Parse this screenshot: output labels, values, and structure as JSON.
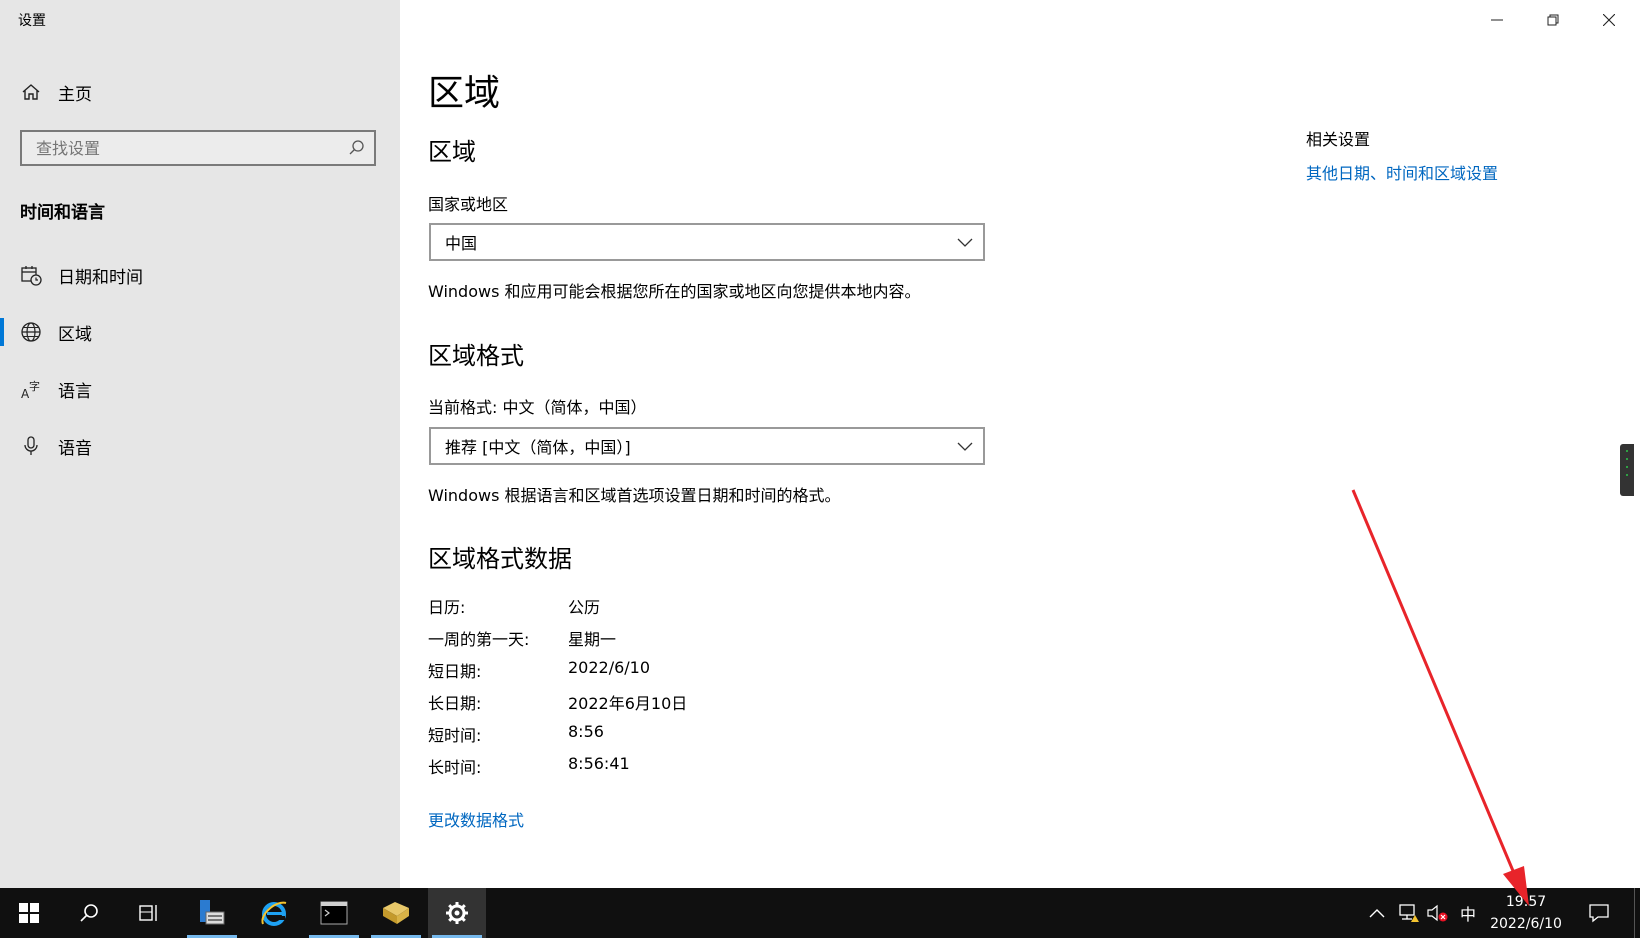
{
  "window": {
    "title": "设置"
  },
  "sidebar": {
    "home_label": "主页",
    "search_placeholder": "查找设置",
    "section_label": "时间和语言",
    "items": [
      {
        "label": "日期和时间",
        "icon": "calendar-clock-icon",
        "active": false
      },
      {
        "label": "区域",
        "icon": "globe-icon",
        "active": true
      },
      {
        "label": "语言",
        "icon": "language-icon",
        "active": false
      },
      {
        "label": "语音",
        "icon": "microphone-icon",
        "active": false
      }
    ]
  },
  "main": {
    "page_title": "区域",
    "region": {
      "heading": "区域",
      "country_label": "国家或地区",
      "country_value": "中国",
      "description": "Windows 和应用可能会根据您所在的国家或地区向您提供本地内容。"
    },
    "format": {
      "heading": "区域格式",
      "current_label": "当前格式: 中文（简体，中国）",
      "dropdown_value": "推荐 [中文（简体，中国）]",
      "description": "Windows 根据语言和区域首选项设置日期和时间的格式。"
    },
    "format_data": {
      "heading": "区域格式数据",
      "rows": [
        {
          "key": "日历:",
          "value": "公历"
        },
        {
          "key": "一周的第一天:",
          "value": "星期一"
        },
        {
          "key": "短日期:",
          "value": "2022/6/10"
        },
        {
          "key": "长日期:",
          "value": "2022年6月10日"
        },
        {
          "key": "短时间:",
          "value": "8:56"
        },
        {
          "key": "长时间:",
          "value": "8:56:41"
        }
      ],
      "change_link": "更改数据格式"
    },
    "related": {
      "title": "相关设置",
      "link": "其他日期、时间和区域设置"
    }
  },
  "taskbar": {
    "apps": [
      "start-icon",
      "search-icon",
      "task-view-icon",
      "server-manager-icon",
      "internet-explorer-icon",
      "command-prompt-icon",
      "file-explorer-icon",
      "settings-gear-icon"
    ],
    "ime": "中",
    "clock_time": "19:57",
    "clock_date": "2022/6/10"
  },
  "colors": {
    "accent": "#0078d7",
    "link": "#0067c0",
    "sidebar_bg": "#e6e6e6",
    "taskbar_bg": "#101010",
    "annotation_arrow": "#e8242a"
  }
}
